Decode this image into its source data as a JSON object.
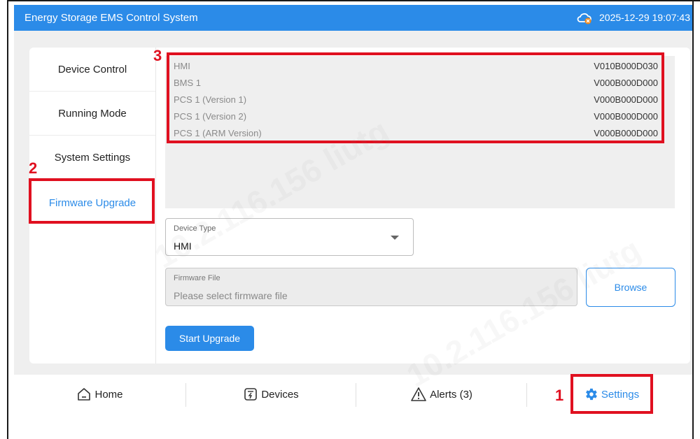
{
  "app": {
    "title": "Energy Storage EMS Control System",
    "datetime": "2025-12-29 19:07:43",
    "status_icon": "cloud-disconnected-icon"
  },
  "sidebar": {
    "items": [
      {
        "label": "Device Control",
        "active": false
      },
      {
        "label": "Running Mode",
        "active": false
      },
      {
        "label": "System Settings",
        "active": false
      },
      {
        "label": "Firmware Upgrade",
        "active": true
      }
    ]
  },
  "versions": [
    {
      "name": "HMI",
      "value": "V010B000D030"
    },
    {
      "name": "BMS 1",
      "value": "V000B000D000"
    },
    {
      "name": "PCS 1 (Version 1)",
      "value": "V000B000D000"
    },
    {
      "name": "PCS 1 (Version 2)",
      "value": "V000B000D000"
    },
    {
      "name": "PCS 1 (ARM Version)",
      "value": "V000B000D000"
    }
  ],
  "device_type": {
    "label": "Device Type",
    "value": "HMI"
  },
  "firmware_file": {
    "label": "Firmware File",
    "placeholder": "Please select firmware file"
  },
  "buttons": {
    "browse": "Browse",
    "start_upgrade": "Start Upgrade"
  },
  "tabs": [
    {
      "label": "Home",
      "icon": "home-icon",
      "active": false
    },
    {
      "label": "Devices",
      "icon": "devices-icon",
      "active": false
    },
    {
      "label": "Alerts (3)",
      "icon": "alert-icon",
      "active": false
    },
    {
      "label": "Settings",
      "icon": "gear-icon",
      "active": true
    }
  ],
  "annotations": [
    "1",
    "2",
    "3"
  ],
  "watermark": "10.2.116.156 liutg",
  "colors": {
    "accent": "#2b8be8",
    "annotation": "#e01020"
  }
}
